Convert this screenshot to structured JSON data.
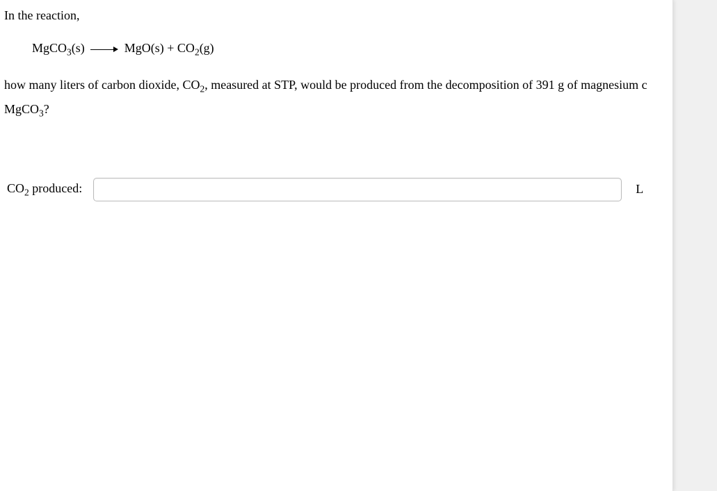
{
  "intro": "In the reaction,",
  "equation": {
    "lhs": "MgCO",
    "lhs_sub": "3",
    "lhs_state": "(s)",
    "rhs1": "MgO(s)",
    "plus": " + ",
    "rhs2": "CO",
    "rhs2_sub": "2",
    "rhs2_state": "(g)"
  },
  "question": {
    "part1": "how many liters of carbon dioxide, CO",
    "sub1": "2",
    "part2": ", measured at STP, would be produced from the decomposition of 391 g of magnesium c",
    "part3": "MgCO",
    "sub2": "3",
    "part4": "?"
  },
  "answer": {
    "label_pre": "CO",
    "label_sub": "2",
    "label_post": " produced:",
    "value": "",
    "unit": "L"
  }
}
